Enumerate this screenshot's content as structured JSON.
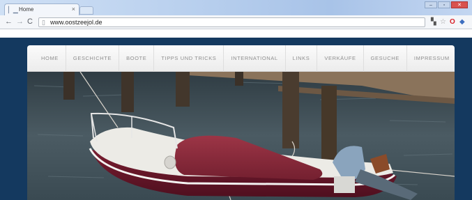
{
  "browser": {
    "tab_title": "Home",
    "tab_close": "×",
    "url": "www.oostzeejol.de"
  },
  "site": {
    "menu": [
      "HOME",
      "GESCHICHTE",
      "BOOTE",
      "TIPPS UND TRICKS",
      "INTERNATIONAL",
      "LINKS",
      "VERKÄUFE",
      "GESUCHE",
      "IMPRESSUM"
    ]
  },
  "colors": {
    "site_background": "#14395f",
    "hull": "#6e1a2c",
    "cover": "#8b2b3a",
    "water": "#3d4b52"
  },
  "icons": {
    "back": "back-arrow-icon",
    "forward": "forward-arrow-icon",
    "reload": "reload-icon",
    "page": "page-icon",
    "translate": "translate-icon",
    "bookmark": "star-icon"
  }
}
